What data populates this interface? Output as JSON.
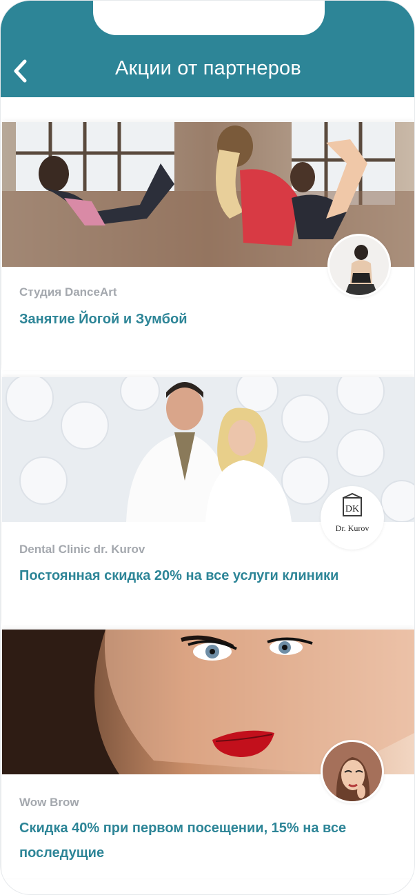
{
  "header": {
    "title": "Акции от партнеров",
    "back_icon": "chevron-left-icon",
    "background_color": "#2d8597"
  },
  "promotions": [
    {
      "partner": "Студия DanceArt",
      "offer": "Занятие Йогой и Зумбой"
    },
    {
      "partner": "Dental Clinic dr. Kurov",
      "offer": "Постоянная скидка 20% на все услуги клиники",
      "logo_text": "Dr. Kurov",
      "logo_monogram": "DK"
    },
    {
      "partner": "Wow Brow",
      "offer": "Скидка 40% при первом посещении, 15% на все последущие"
    }
  ],
  "colors": {
    "accent": "#2d8597",
    "muted_text": "#a4a8ae"
  }
}
